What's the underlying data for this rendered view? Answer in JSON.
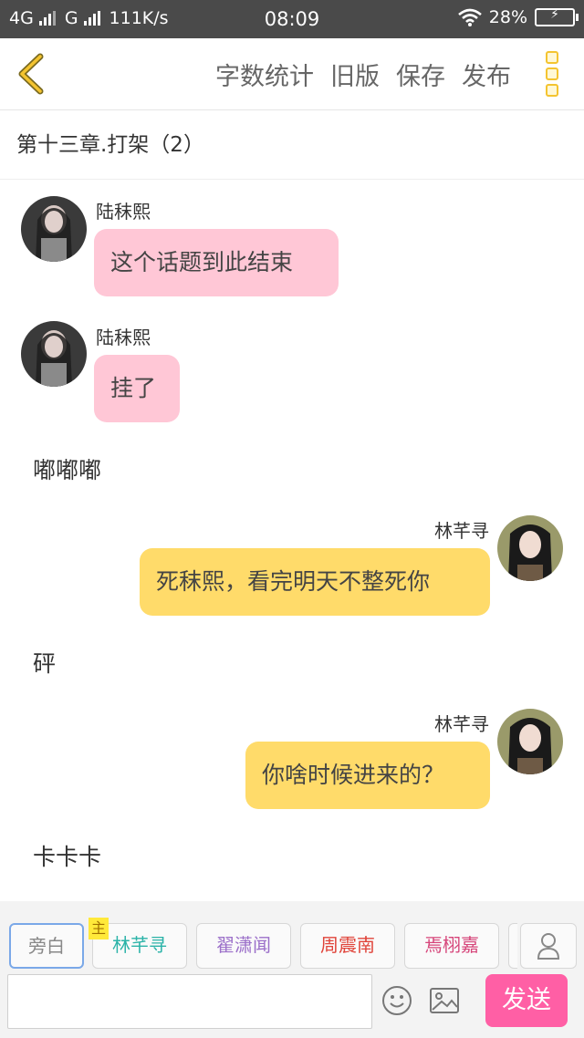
{
  "status": {
    "network1": "4G",
    "network2": "G",
    "speed": "111K/s",
    "time": "08:09",
    "battery": "28%"
  },
  "toolbar": {
    "back_icon": "chevron-left-icon",
    "word_count": "字数统计",
    "old_version": "旧版",
    "save": "保存",
    "publish": "发布",
    "more_icon": "more-vertical-icon",
    "accent": "#f4c430"
  },
  "chapter": {
    "title": "第十三章.打架（2）"
  },
  "messages": [
    {
      "sender": "陆秣熙",
      "text": "这个话题到此结束",
      "side": "left",
      "color": "#ffc7d6"
    },
    {
      "sender": "陆秣熙",
      "text": "挂了",
      "side": "left",
      "color": "#ffc7d6"
    },
    {
      "narration": "嘟嘟嘟"
    },
    {
      "sender": "林芊寻",
      "text": "死秣熙，看完明天不整死你",
      "side": "right",
      "color": "#ffdb6a"
    },
    {
      "narration": "砰"
    },
    {
      "sender": "林芊寻",
      "text": "你啥时候进来的？",
      "side": "right",
      "color": "#ffdb6a"
    },
    {
      "narration": "卡卡卡"
    }
  ],
  "characters": {
    "narrator": "旁白",
    "main_tag": "主",
    "c1": {
      "name": "林芊寻",
      "color": "#2bb3a8"
    },
    "c2": {
      "name": "翟潇闻",
      "color": "#9b6fc9"
    },
    "c3": {
      "name": "周震南",
      "color": "#e0443a"
    },
    "c4": {
      "name": "焉栩嘉",
      "color": "#d6457a"
    },
    "add_icon": "person-icon"
  },
  "input": {
    "value": "",
    "placeholder": "",
    "emoji_icon": "emoji-icon",
    "image_icon": "image-icon",
    "send": "发送",
    "send_color": "#ff5fa5"
  }
}
